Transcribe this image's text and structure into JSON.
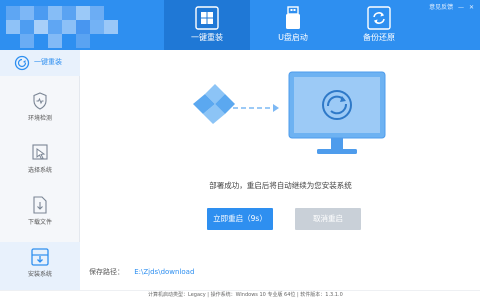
{
  "header": {
    "tabs": [
      {
        "label": "一键重装",
        "icon": "windows-icon",
        "active": true
      },
      {
        "label": "U盘启动",
        "icon": "usb-drive-icon",
        "active": false
      },
      {
        "label": "备份还原",
        "icon": "backup-restore-icon",
        "active": false
      }
    ],
    "window_controls": [
      "意见反馈",
      "—",
      "✕"
    ]
  },
  "sidebar": {
    "items": [
      {
        "label": "一键重装",
        "icon": "reinstall-icon",
        "active": true
      },
      {
        "label": "环境检测",
        "icon": "shield-check-icon",
        "active": false
      },
      {
        "label": "选择系统",
        "icon": "cursor-select-icon",
        "active": false
      },
      {
        "label": "下载文件",
        "icon": "download-file-icon",
        "active": false
      },
      {
        "label": "安装系统",
        "icon": "install-system-icon",
        "active": true
      }
    ]
  },
  "main": {
    "status": "部署成功，重启后将自动继续为您安装系统",
    "restart_button": "立即重启（9s）",
    "cancel_button": "取消重启",
    "save_path_label": "保存路径：",
    "save_path_value": "E:\\Zjds\\download"
  },
  "footer": {
    "text": "计算机启动类型：Legacy | 操作系统：Windows 10 专业版 64位 | 软件版本：1.3.1.0"
  },
  "colors": {
    "brand_blue": "#2e8ff0",
    "active_tab": "#1f78d6",
    "sidebar_bg": "#f5f7fa",
    "illustration_blue": "#5ba8f0"
  }
}
